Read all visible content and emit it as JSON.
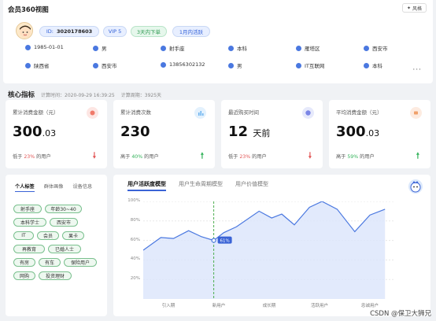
{
  "header": {
    "title": "会员360视图",
    "style_button": "风格"
  },
  "profile": {
    "id_label": "ID:",
    "id_value": "3020178603",
    "tags": [
      "VIP 5",
      "3天内下单",
      "1月内活跃"
    ],
    "info_row1": [
      {
        "icon": "calendar-icon",
        "text": "1985-01-01"
      },
      {
        "icon": "gender-icon",
        "text": "男"
      },
      {
        "icon": "zodiac-icon",
        "text": "射手座"
      },
      {
        "icon": "education-icon",
        "text": "本科"
      },
      {
        "icon": "district-icon",
        "text": "雁塔区"
      },
      {
        "icon": "city-icon",
        "text": "西安市"
      }
    ],
    "info_row2": [
      {
        "icon": "province-icon",
        "text": "陕西省"
      },
      {
        "icon": "city-icon",
        "text": "西安市"
      },
      {
        "icon": "phone-icon",
        "text": "13856302132"
      },
      {
        "icon": "gender-icon",
        "text": "男"
      },
      {
        "icon": "industry-icon",
        "text": "IT互联网"
      },
      {
        "icon": "education-icon",
        "text": "本科"
      }
    ],
    "more": "···"
  },
  "core": {
    "title": "核心指标",
    "calc_time": "计算时间：2020-09-29 16:39:25",
    "calc_period": "计算周期：3925天"
  },
  "metrics": [
    {
      "label": "累计消费金额（元）",
      "int": "300",
      "dec": ".03",
      "unit": "",
      "note_pre": "低于",
      "pct": "23%",
      "note_post": "的用户",
      "trend": "down",
      "icon_color": "#fde6e3",
      "icon_dot": "#f07a6a"
    },
    {
      "label": "累计消费次数",
      "int": "230",
      "dec": "",
      "unit": "",
      "note_pre": "高于",
      "pct": "40%",
      "note_post": "的用户",
      "trend": "up",
      "icon_color": "#e3f1fd",
      "icon_dot": "#6ab2f0"
    },
    {
      "label": "最近购买时间",
      "int": "12",
      "dec": "",
      "unit": "天前",
      "note_pre": "低于",
      "pct": "23%",
      "note_post": "的用户",
      "trend": "down",
      "icon_color": "#e6e9fb",
      "icon_dot": "#7b86e6"
    },
    {
      "label": "平均消费金额（元）",
      "int": "300",
      "dec": ".03",
      "unit": "",
      "note_pre": "高于",
      "pct": "59%",
      "note_post": "的用户",
      "trend": "up",
      "icon_color": "#fdebe0",
      "icon_dot": "#f0a06a"
    }
  ],
  "left_panel": {
    "tabs": [
      "个人标签",
      "群体画像",
      "设备信息"
    ],
    "tags": [
      "射手座",
      "年龄30~40",
      "本科学士",
      "西安市",
      "IT",
      "会员",
      "果卡",
      "再教育",
      "已婚人士",
      "有房",
      "有车",
      "保险用户",
      "网购",
      "投资理财"
    ]
  },
  "chart_tabs": [
    "用户活跃度模型",
    "用户生命周期模型",
    "用户价值模型"
  ],
  "chart_data": {
    "type": "area",
    "categories": [
      "引入期",
      "新用户",
      "成长期",
      "活跃用户",
      "忠诚用户"
    ],
    "x": [
      0,
      0.35,
      0.6,
      0.9,
      1.15,
      1.4,
      1.6,
      1.85,
      2.3,
      2.55,
      2.75,
      3.0,
      3.3,
      3.55,
      3.85,
      4.2,
      4.5,
      4.8
    ],
    "y": [
      0.5,
      0.63,
      0.62,
      0.7,
      0.64,
      0.6,
      0.68,
      0.74,
      0.9,
      0.83,
      0.87,
      0.76,
      0.94,
      1.0,
      0.92,
      0.69,
      0.86,
      0.92
    ],
    "yticks": [
      "100%",
      "80%",
      "60%",
      "40%",
      "20%"
    ],
    "ylim": [
      0,
      1.0
    ],
    "marker": {
      "index": 5,
      "label": "61%"
    },
    "line_color": "#4a78e0",
    "fill_color": "#dbe5fb"
  },
  "watermark": "CSDN @保卫大狮兄"
}
